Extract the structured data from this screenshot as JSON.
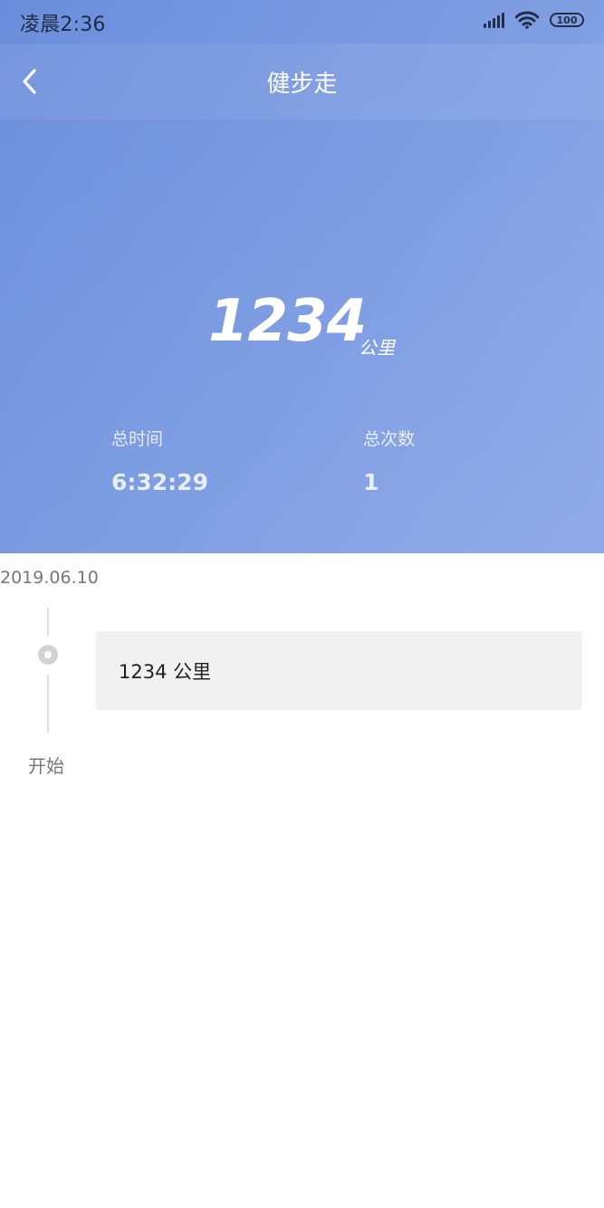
{
  "status_bar": {
    "time": "凌晨2:36",
    "battery": "100",
    "icons": [
      "signal-icon",
      "wifi-icon",
      "battery-icon"
    ]
  },
  "nav": {
    "title": "健步走",
    "back_icon": "chevron-left-icon"
  },
  "summary": {
    "distance_value": "1234",
    "distance_unit": "公里",
    "total_time_label": "总时间",
    "total_time_value": "6:32:29",
    "total_count_label": "总次数",
    "total_count_value": "1"
  },
  "timeline": {
    "date": "2019.06.10",
    "records": [
      {
        "text": "1234 公里"
      }
    ],
    "start_label": "开始"
  },
  "colors": {
    "hero_gradient_start": "#6b8edc",
    "hero_gradient_end": "#8aa6e6",
    "card_background": "#f1f1f1",
    "muted_text": "#777777"
  }
}
